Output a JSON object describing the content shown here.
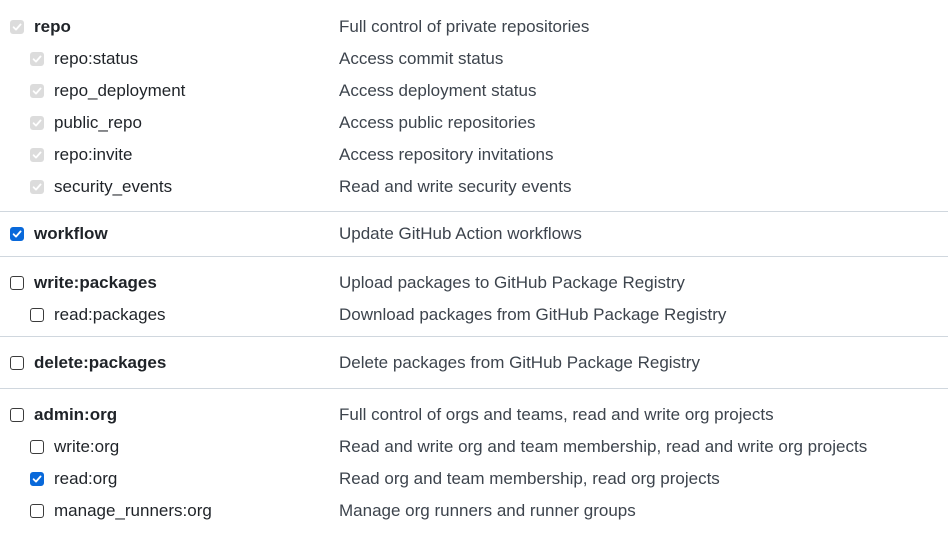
{
  "groups": [
    {
      "id": "repo",
      "scopes": [
        {
          "key": "repo",
          "name": "repo",
          "description": "Full control of private repositories",
          "level": "parent",
          "state": "checked-disabled"
        },
        {
          "key": "repo-status",
          "name": "repo:status",
          "description": "Access commit status",
          "level": "child",
          "state": "checked-disabled"
        },
        {
          "key": "repo-deployment",
          "name": "repo_deployment",
          "description": "Access deployment status",
          "level": "child",
          "state": "checked-disabled"
        },
        {
          "key": "public-repo",
          "name": "public_repo",
          "description": "Access public repositories",
          "level": "child",
          "state": "checked-disabled"
        },
        {
          "key": "repo-invite",
          "name": "repo:invite",
          "description": "Access repository invitations",
          "level": "child",
          "state": "checked-disabled"
        },
        {
          "key": "security-events",
          "name": "security_events",
          "description": "Read and write security events",
          "level": "child",
          "state": "checked-disabled"
        }
      ]
    },
    {
      "id": "workflow",
      "scopes": [
        {
          "key": "workflow",
          "name": "workflow",
          "description": "Update GitHub Action workflows",
          "level": "parent",
          "state": "checked"
        }
      ]
    },
    {
      "id": "write-packages",
      "scopes": [
        {
          "key": "write-packages",
          "name": "write:packages",
          "description": "Upload packages to GitHub Package Registry",
          "level": "parent",
          "state": "unchecked"
        },
        {
          "key": "read-packages",
          "name": "read:packages",
          "description": "Download packages from GitHub Package Registry",
          "level": "child",
          "state": "unchecked"
        }
      ]
    },
    {
      "id": "delete-packages",
      "scopes": [
        {
          "key": "delete-packages",
          "name": "delete:packages",
          "description": "Delete packages from GitHub Package Registry",
          "level": "parent",
          "state": "unchecked"
        }
      ]
    },
    {
      "id": "admin-org",
      "scopes": [
        {
          "key": "admin-org",
          "name": "admin:org",
          "description": "Full control of orgs and teams, read and write org projects",
          "level": "parent",
          "state": "unchecked"
        },
        {
          "key": "write-org",
          "name": "write:org",
          "description": "Read and write org and team membership, read and write org projects",
          "level": "child",
          "state": "unchecked"
        },
        {
          "key": "read-org",
          "name": "read:org",
          "description": "Read org and team membership, read org projects",
          "level": "child",
          "state": "checked"
        },
        {
          "key": "manage-runners-org",
          "name": "manage_runners:org",
          "description": "Manage org runners and runner groups",
          "level": "child",
          "state": "unchecked"
        }
      ]
    }
  ],
  "colors": {
    "checked": "#0969da",
    "checked_disabled": "#dcdcdc",
    "border": "#d0d7de"
  },
  "icons": {
    "checkmark": "checkmark-icon"
  }
}
